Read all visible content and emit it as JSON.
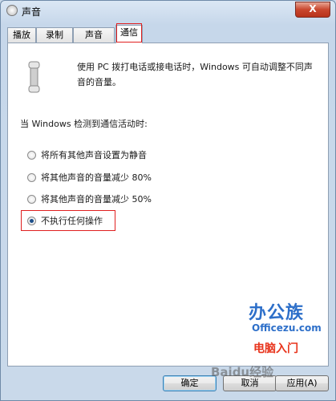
{
  "window": {
    "title": "声音",
    "close_label": "X"
  },
  "tabs": [
    {
      "label": "播放"
    },
    {
      "label": "录制"
    },
    {
      "label": "声音"
    },
    {
      "label": "通信"
    }
  ],
  "panel": {
    "description": "使用 PC 拨打电话或接电话时，Windows 可自动调整不同声音的音量。",
    "prompt": "当 Windows 检测到通信活动时:",
    "options": [
      {
        "label": "将所有其他声音设置为静音",
        "checked": false
      },
      {
        "label": "将其他声音的音量减少 80%",
        "checked": false
      },
      {
        "label": "将其他声音的音量减少 50%",
        "checked": false
      },
      {
        "label": "不执行任何操作",
        "checked": true
      }
    ]
  },
  "watermark": {
    "brand": "办公族",
    "site": "Officezu.com",
    "slogan": "电脑入门",
    "baidu": "Baidu经验"
  },
  "footer": {
    "ok_label": "确定",
    "cancel_label": "取消",
    "apply_label": "应用(A)"
  }
}
